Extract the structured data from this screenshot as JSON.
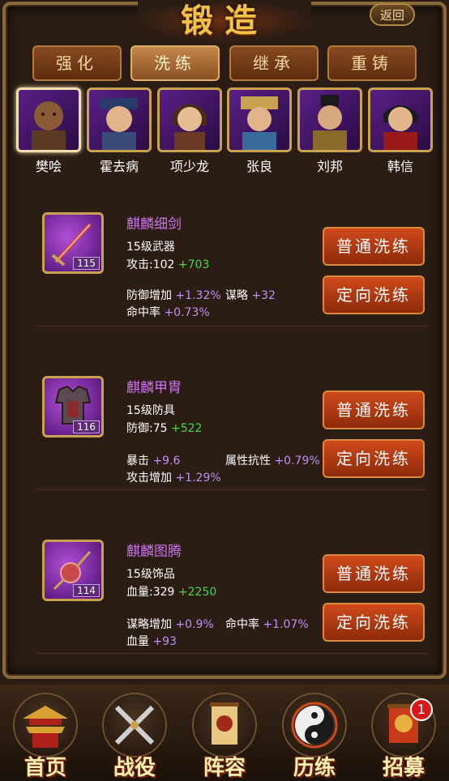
{
  "title": "锻造",
  "back_label": "返回",
  "tabs": [
    {
      "label": "强化",
      "active": false
    },
    {
      "label": "洗练",
      "active": true
    },
    {
      "label": "继承",
      "active": false
    },
    {
      "label": "重铸",
      "active": false
    }
  ],
  "heroes": [
    {
      "name": "樊哙",
      "selected": true
    },
    {
      "name": "霍去病",
      "selected": false
    },
    {
      "name": "项少龙",
      "selected": false
    },
    {
      "name": "张良",
      "selected": false
    },
    {
      "name": "刘邦",
      "selected": false
    },
    {
      "name": "韩信",
      "selected": false
    }
  ],
  "items": [
    {
      "name": "麒麟细剑",
      "level": "115",
      "type": "15级武器",
      "main_label": "攻击:102",
      "main_bonus": "+703",
      "sub1_label": "防御增加",
      "sub1_value": "+1.32%",
      "sub2_label": "谋略",
      "sub2_value": "+32",
      "sub3_label": "命中率",
      "sub3_value": "+0.73%",
      "btn_normal": "普通洗练",
      "btn_directed": "定向洗练"
    },
    {
      "name": "麒麟甲胄",
      "level": "116",
      "type": "15级防具",
      "main_label": "防御:75",
      "main_bonus": "+522",
      "sub1_label": "暴击",
      "sub1_value": "+9.6",
      "sub2_label": "属性抗性",
      "sub2_value": "+0.79%",
      "sub3_label": "攻击增加",
      "sub3_value": "+1.29%",
      "btn_normal": "普通洗练",
      "btn_directed": "定向洗练"
    },
    {
      "name": "麒麟图腾",
      "level": "114",
      "type": "15级饰品",
      "main_label": "血量:329",
      "main_bonus": "+2250",
      "sub1_label": "谋略增加",
      "sub1_value": "+0.9%",
      "sub2_label": "命中率",
      "sub2_value": "+1.07%",
      "sub3_label": "血量",
      "sub3_value": "+93",
      "btn_normal": "普通洗练",
      "btn_directed": "定向洗练"
    }
  ],
  "nav": [
    {
      "label": "首页",
      "icon": "palace-icon"
    },
    {
      "label": "战役",
      "icon": "crossed-swords-icon"
    },
    {
      "label": "阵容",
      "icon": "banner-icon"
    },
    {
      "label": "历练",
      "icon": "yin-yang-icon"
    },
    {
      "label": "招募",
      "icon": "recruit-banner-icon"
    }
  ],
  "recruit_badge": "1",
  "colors": {
    "accent_gold": "#f0c24a",
    "item_name": "#c974e8",
    "bonus_green": "#44d84c",
    "sub_stat": "#b993f2",
    "button_red": "#d04a1c"
  }
}
